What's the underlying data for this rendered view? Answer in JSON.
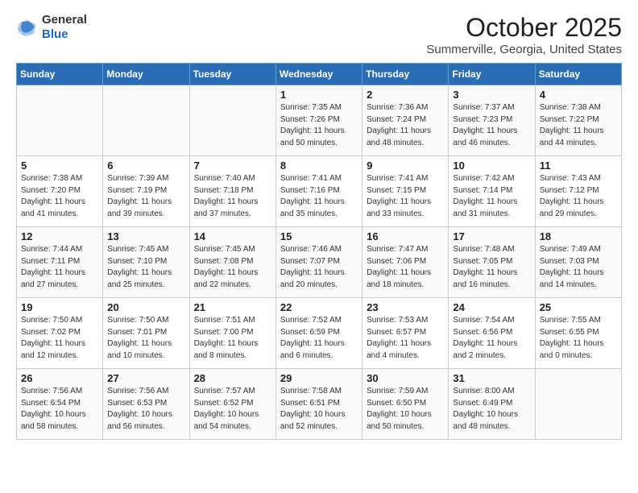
{
  "header": {
    "logo_line1": "General",
    "logo_line2": "Blue",
    "month": "October 2025",
    "location": "Summerville, Georgia, United States"
  },
  "days_of_week": [
    "Sunday",
    "Monday",
    "Tuesday",
    "Wednesday",
    "Thursday",
    "Friday",
    "Saturday"
  ],
  "weeks": [
    [
      {
        "day": "",
        "info": ""
      },
      {
        "day": "",
        "info": ""
      },
      {
        "day": "",
        "info": ""
      },
      {
        "day": "1",
        "info": "Sunrise: 7:35 AM\nSunset: 7:26 PM\nDaylight: 11 hours\nand 50 minutes."
      },
      {
        "day": "2",
        "info": "Sunrise: 7:36 AM\nSunset: 7:24 PM\nDaylight: 11 hours\nand 48 minutes."
      },
      {
        "day": "3",
        "info": "Sunrise: 7:37 AM\nSunset: 7:23 PM\nDaylight: 11 hours\nand 46 minutes."
      },
      {
        "day": "4",
        "info": "Sunrise: 7:38 AM\nSunset: 7:22 PM\nDaylight: 11 hours\nand 44 minutes."
      }
    ],
    [
      {
        "day": "5",
        "info": "Sunrise: 7:38 AM\nSunset: 7:20 PM\nDaylight: 11 hours\nand 41 minutes."
      },
      {
        "day": "6",
        "info": "Sunrise: 7:39 AM\nSunset: 7:19 PM\nDaylight: 11 hours\nand 39 minutes."
      },
      {
        "day": "7",
        "info": "Sunrise: 7:40 AM\nSunset: 7:18 PM\nDaylight: 11 hours\nand 37 minutes."
      },
      {
        "day": "8",
        "info": "Sunrise: 7:41 AM\nSunset: 7:16 PM\nDaylight: 11 hours\nand 35 minutes."
      },
      {
        "day": "9",
        "info": "Sunrise: 7:41 AM\nSunset: 7:15 PM\nDaylight: 11 hours\nand 33 minutes."
      },
      {
        "day": "10",
        "info": "Sunrise: 7:42 AM\nSunset: 7:14 PM\nDaylight: 11 hours\nand 31 minutes."
      },
      {
        "day": "11",
        "info": "Sunrise: 7:43 AM\nSunset: 7:12 PM\nDaylight: 11 hours\nand 29 minutes."
      }
    ],
    [
      {
        "day": "12",
        "info": "Sunrise: 7:44 AM\nSunset: 7:11 PM\nDaylight: 11 hours\nand 27 minutes."
      },
      {
        "day": "13",
        "info": "Sunrise: 7:45 AM\nSunset: 7:10 PM\nDaylight: 11 hours\nand 25 minutes."
      },
      {
        "day": "14",
        "info": "Sunrise: 7:45 AM\nSunset: 7:08 PM\nDaylight: 11 hours\nand 22 minutes."
      },
      {
        "day": "15",
        "info": "Sunrise: 7:46 AM\nSunset: 7:07 PM\nDaylight: 11 hours\nand 20 minutes."
      },
      {
        "day": "16",
        "info": "Sunrise: 7:47 AM\nSunset: 7:06 PM\nDaylight: 11 hours\nand 18 minutes."
      },
      {
        "day": "17",
        "info": "Sunrise: 7:48 AM\nSunset: 7:05 PM\nDaylight: 11 hours\nand 16 minutes."
      },
      {
        "day": "18",
        "info": "Sunrise: 7:49 AM\nSunset: 7:03 PM\nDaylight: 11 hours\nand 14 minutes."
      }
    ],
    [
      {
        "day": "19",
        "info": "Sunrise: 7:50 AM\nSunset: 7:02 PM\nDaylight: 11 hours\nand 12 minutes."
      },
      {
        "day": "20",
        "info": "Sunrise: 7:50 AM\nSunset: 7:01 PM\nDaylight: 11 hours\nand 10 minutes."
      },
      {
        "day": "21",
        "info": "Sunrise: 7:51 AM\nSunset: 7:00 PM\nDaylight: 11 hours\nand 8 minutes."
      },
      {
        "day": "22",
        "info": "Sunrise: 7:52 AM\nSunset: 6:59 PM\nDaylight: 11 hours\nand 6 minutes."
      },
      {
        "day": "23",
        "info": "Sunrise: 7:53 AM\nSunset: 6:57 PM\nDaylight: 11 hours\nand 4 minutes."
      },
      {
        "day": "24",
        "info": "Sunrise: 7:54 AM\nSunset: 6:56 PM\nDaylight: 11 hours\nand 2 minutes."
      },
      {
        "day": "25",
        "info": "Sunrise: 7:55 AM\nSunset: 6:55 PM\nDaylight: 11 hours\nand 0 minutes."
      }
    ],
    [
      {
        "day": "26",
        "info": "Sunrise: 7:56 AM\nSunset: 6:54 PM\nDaylight: 10 hours\nand 58 minutes."
      },
      {
        "day": "27",
        "info": "Sunrise: 7:56 AM\nSunset: 6:53 PM\nDaylight: 10 hours\nand 56 minutes."
      },
      {
        "day": "28",
        "info": "Sunrise: 7:57 AM\nSunset: 6:52 PM\nDaylight: 10 hours\nand 54 minutes."
      },
      {
        "day": "29",
        "info": "Sunrise: 7:58 AM\nSunset: 6:51 PM\nDaylight: 10 hours\nand 52 minutes."
      },
      {
        "day": "30",
        "info": "Sunrise: 7:59 AM\nSunset: 6:50 PM\nDaylight: 10 hours\nand 50 minutes."
      },
      {
        "day": "31",
        "info": "Sunrise: 8:00 AM\nSunset: 6:49 PM\nDaylight: 10 hours\nand 48 minutes."
      },
      {
        "day": "",
        "info": ""
      }
    ]
  ]
}
